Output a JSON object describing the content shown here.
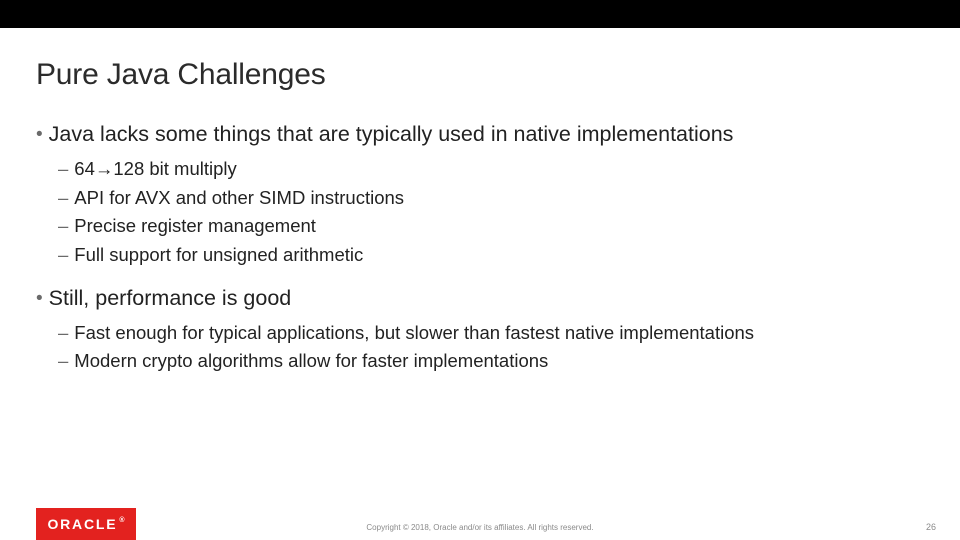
{
  "title": "Pure Java Challenges",
  "points": [
    {
      "text": "Java lacks some things that are typically used in native implementations",
      "sub": [
        "64→128 bit multiply",
        "API for AVX and other SIMD instructions",
        "Precise register management",
        "Full support for unsigned arithmetic"
      ]
    },
    {
      "text": "Still, performance is good",
      "sub": [
        "Fast enough for typical applications, but slower than fastest native implementations",
        "Modern crypto algorithms allow for faster implementations"
      ]
    }
  ],
  "logo_text": "ORACLE",
  "logo_reg": "®",
  "copyright": "Copyright © 2018, Oracle and/or its affiliates. All rights reserved.",
  "page_number": "26",
  "colors": {
    "top_bar": "#000000",
    "brand_red": "#e3221f",
    "text": "#222222"
  }
}
